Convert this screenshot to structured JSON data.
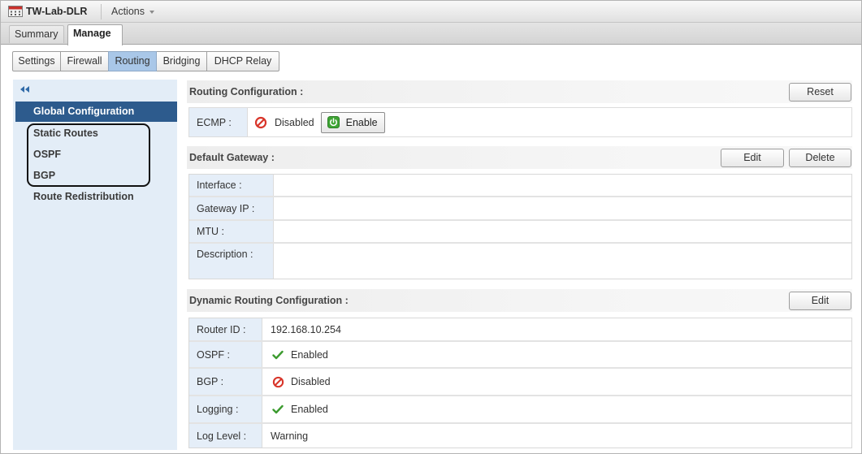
{
  "header": {
    "title": "TW-Lab-DLR",
    "icon": "edge-router-icon",
    "actions_label": "Actions",
    "actions_icon": "chevron-down-icon"
  },
  "main_tabs": [
    {
      "label": "Summary",
      "selected": false
    },
    {
      "label": "Manage",
      "selected": true
    }
  ],
  "sub_tabs": [
    {
      "label": "Settings",
      "selected": false
    },
    {
      "label": "Firewall",
      "selected": false
    },
    {
      "label": "Routing",
      "selected": true
    },
    {
      "label": "Bridging",
      "selected": false
    },
    {
      "label": "DHCP Relay",
      "selected": false
    }
  ],
  "sidebar": {
    "collapse_icon": "collapse-sidebar-icon",
    "items": [
      {
        "label": "Global Configuration",
        "selected": true
      },
      {
        "label": "Static Routes",
        "selected": false
      },
      {
        "label": "OSPF",
        "selected": false
      },
      {
        "label": "BGP",
        "selected": false
      },
      {
        "label": "Route Redistribution",
        "selected": false
      }
    ]
  },
  "routing_configuration": {
    "title": "Routing Configuration :",
    "reset_label": "Reset",
    "ecmp": {
      "label": "ECMP :",
      "status": "Disabled",
      "status_icon": "disabled-icon",
      "enable_label": "Enable",
      "enable_icon": "power-icon"
    }
  },
  "default_gateway": {
    "title": "Default Gateway :",
    "edit_label": "Edit",
    "delete_label": "Delete",
    "rows": [
      {
        "label": "Interface :",
        "value": ""
      },
      {
        "label": "Gateway IP :",
        "value": ""
      },
      {
        "label": "MTU :",
        "value": ""
      },
      {
        "label": "Description :",
        "value": ""
      }
    ]
  },
  "dynamic_routing": {
    "title": "Dynamic Routing Configuration :",
    "edit_label": "Edit",
    "rows": [
      {
        "label": "Router ID :",
        "value": "192.168.10.254"
      },
      {
        "label": "OSPF :",
        "value": "Enabled",
        "icon": "check-icon"
      },
      {
        "label": "BGP :",
        "value": "Disabled",
        "icon": "disabled-icon"
      },
      {
        "label": "Logging :",
        "value": "Enabled",
        "icon": "check-icon"
      },
      {
        "label": "Log Level :",
        "value": "Warning"
      }
    ]
  },
  "colors": {
    "nav_selected_bg": "#2d5b8d",
    "sidebar_bg": "#e3edf7",
    "label_cell_bg": "#e5eef8",
    "subtab_selected_bg": "#a9c7e8",
    "enabled_green": "#3c9b2f",
    "disabled_red": "#d8352a",
    "highlight_outline": "#111111"
  }
}
